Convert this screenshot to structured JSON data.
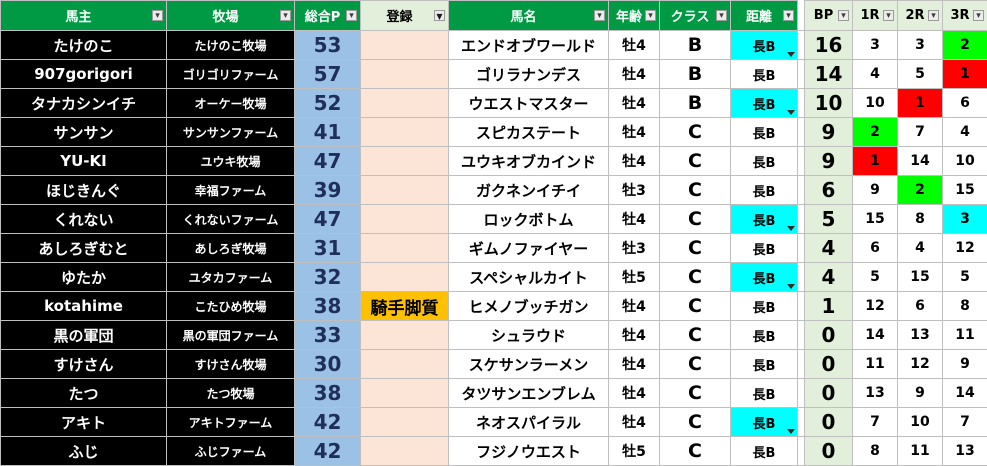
{
  "headers": {
    "owner": "馬主",
    "farm": "牧場",
    "points": "総合P",
    "registration": "登録",
    "horse": "馬名",
    "age": "年齢",
    "class": "クラス",
    "distance": "距離",
    "bp": "BP",
    "r1": "1R",
    "r2": "2R",
    "r3": "3R"
  },
  "rows": [
    {
      "owner": "たけのこ",
      "farm": "たけのこ牧場",
      "points": "53",
      "reg": "",
      "horse": "エンドオブワールド",
      "age": "牡4",
      "cls": "B",
      "dist": "長B",
      "bp": "16",
      "r1": "3",
      "r2": "3",
      "r3": "2"
    },
    {
      "owner": "907gorigori",
      "farm": "ゴリゴリファーム",
      "points": "57",
      "reg": "",
      "horse": "ゴリラナンデス",
      "age": "牡4",
      "cls": "B",
      "dist": "長B",
      "bp": "14",
      "r1": "4",
      "r2": "5",
      "r3": "1"
    },
    {
      "owner": "タナカシンイチ",
      "farm": "オーケー牧場",
      "points": "52",
      "reg": "",
      "horse": "ウエストマスター",
      "age": "牡4",
      "cls": "B",
      "dist": "長B",
      "bp": "10",
      "r1": "10",
      "r2": "1",
      "r3": "6"
    },
    {
      "owner": "サンサン",
      "farm": "サンサンファーム",
      "points": "41",
      "reg": "",
      "horse": "スピカステート",
      "age": "牡4",
      "cls": "C",
      "dist": "長B",
      "bp": "9",
      "r1": "2",
      "r2": "7",
      "r3": "4"
    },
    {
      "owner": "YU-KI",
      "farm": "ユウキ牧場",
      "points": "47",
      "reg": "",
      "horse": "ユウキオブカインド",
      "age": "牡4",
      "cls": "C",
      "dist": "長B",
      "bp": "9",
      "r1": "1",
      "r2": "14",
      "r3": "10"
    },
    {
      "owner": "ほじきんぐ",
      "farm": "幸福ファーム",
      "points": "39",
      "reg": "",
      "horse": "ガクネンイチイ",
      "age": "牡3",
      "cls": "C",
      "dist": "長B",
      "bp": "6",
      "r1": "9",
      "r2": "2",
      "r3": "15"
    },
    {
      "owner": "くれない",
      "farm": "くれないファーム",
      "points": "47",
      "reg": "",
      "horse": "ロックボトム",
      "age": "牡4",
      "cls": "C",
      "dist": "長B",
      "bp": "5",
      "r1": "15",
      "r2": "8",
      "r3": "3"
    },
    {
      "owner": "あしろぎむと",
      "farm": "あしろぎ牧場",
      "points": "31",
      "reg": "",
      "horse": "ギムノファイヤー",
      "age": "牡3",
      "cls": "C",
      "dist": "長B",
      "bp": "4",
      "r1": "6",
      "r2": "4",
      "r3": "12"
    },
    {
      "owner": "ゆたか",
      "farm": "ユタカファーム",
      "points": "32",
      "reg": "",
      "horse": "スペシャルカイト",
      "age": "牡5",
      "cls": "C",
      "dist": "長B",
      "bp": "4",
      "r1": "5",
      "r2": "15",
      "r3": "5"
    },
    {
      "owner": "kotahime",
      "farm": "こたひめ牧場",
      "points": "38",
      "reg": "騎手脚質",
      "horse": "ヒメノブッチガン",
      "age": "牡4",
      "cls": "C",
      "dist": "長B",
      "bp": "1",
      "r1": "12",
      "r2": "6",
      "r3": "8"
    },
    {
      "owner": "黒の軍団",
      "farm": "黒の軍団ファーム",
      "points": "33",
      "reg": "",
      "horse": "シュラウド",
      "age": "牡4",
      "cls": "C",
      "dist": "長B",
      "bp": "0",
      "r1": "14",
      "r2": "13",
      "r3": "11"
    },
    {
      "owner": "すけさん",
      "farm": "すけさん牧場",
      "points": "30",
      "reg": "",
      "horse": "スケサンラーメン",
      "age": "牡4",
      "cls": "C",
      "dist": "長B",
      "bp": "0",
      "r1": "11",
      "r2": "12",
      "r3": "9"
    },
    {
      "owner": "たつ",
      "farm": "たつ牧場",
      "points": "38",
      "reg": "",
      "horse": "タツサンエンブレム",
      "age": "牡4",
      "cls": "C",
      "dist": "長B",
      "bp": "0",
      "r1": "13",
      "r2": "9",
      "r3": "14"
    },
    {
      "owner": "アキト",
      "farm": "アキトファーム",
      "points": "42",
      "reg": "",
      "horse": "ネオスパイラル",
      "age": "牡4",
      "cls": "C",
      "dist": "長B",
      "bp": "0",
      "r1": "7",
      "r2": "10",
      "r3": "7"
    },
    {
      "owner": "ふじ",
      "farm": "ふじファーム",
      "points": "42",
      "reg": "",
      "horse": "フジノウエスト",
      "age": "牡5",
      "cls": "C",
      "dist": "長B",
      "bp": "0",
      "r1": "8",
      "r2": "11",
      "r3": "13"
    }
  ],
  "highlights": {
    "distance_cyan_rows": [
      0,
      2,
      6,
      8,
      13
    ],
    "rank_colors": {
      "0": {
        "r3": "#00ff00"
      },
      "1": {
        "r3": "#ff0000"
      },
      "2": {
        "r2": "#ff0000"
      },
      "3": {
        "r1": "#00ff00"
      },
      "4": {
        "r1": "#ff0000"
      },
      "5": {
        "r2": "#00ff00"
      },
      "6": {
        "r3": "#00ffff"
      }
    },
    "register_flag_color": "#ffc000",
    "header_green": "#009a44",
    "points_blue": "#9bc2e6",
    "register_peach": "#fce4d6",
    "bp_pale_green": "#e2efda"
  },
  "icons": {
    "filter": "filter-dropdown-icon",
    "filter_active": "filter-active-icon",
    "cell_dropdown": "dropdown-triangle-icon"
  }
}
